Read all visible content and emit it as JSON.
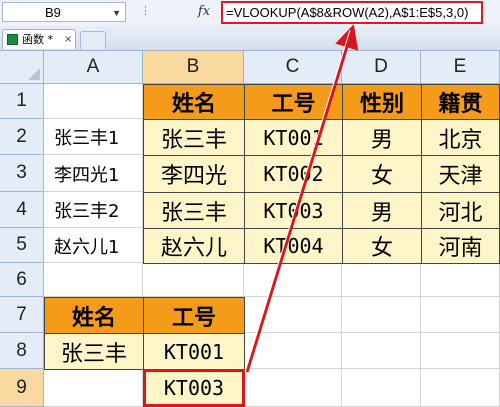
{
  "formula_bar": {
    "cell_ref": "B9",
    "fx_label": "fx",
    "formula": "=VLOOKUP(A$8&ROW(A2),A$1:E$5,3,0)"
  },
  "tab": {
    "title": "函数 *",
    "close": "×"
  },
  "columns": [
    "A",
    "B",
    "C",
    "D",
    "E"
  ],
  "rows": [
    "1",
    "2",
    "3",
    "4",
    "5",
    "6",
    "7",
    "8",
    "9"
  ],
  "table": {
    "headers": [
      "姓名",
      "工号",
      "性别",
      "籍贯"
    ],
    "records": [
      {
        "key": "张三丰1",
        "name": "张三丰",
        "id": "KT001",
        "gender": "男",
        "origin": "北京"
      },
      {
        "key": "李四光1",
        "name": "李四光",
        "id": "KT002",
        "gender": "女",
        "origin": "天津"
      },
      {
        "key": "张三丰2",
        "name": "张三丰",
        "id": "KT003",
        "gender": "男",
        "origin": "河北"
      },
      {
        "key": "赵六儿1",
        "name": "赵六儿",
        "id": "KT004",
        "gender": "女",
        "origin": "河南"
      }
    ]
  },
  "lookup": {
    "headers": [
      "姓名",
      "工号"
    ],
    "name": "张三丰",
    "results": [
      "KT001",
      "KT003"
    ]
  },
  "colors": {
    "header_fill": "#f59b1a",
    "data_fill": "#fef5c8",
    "highlight": "#d8161b"
  }
}
